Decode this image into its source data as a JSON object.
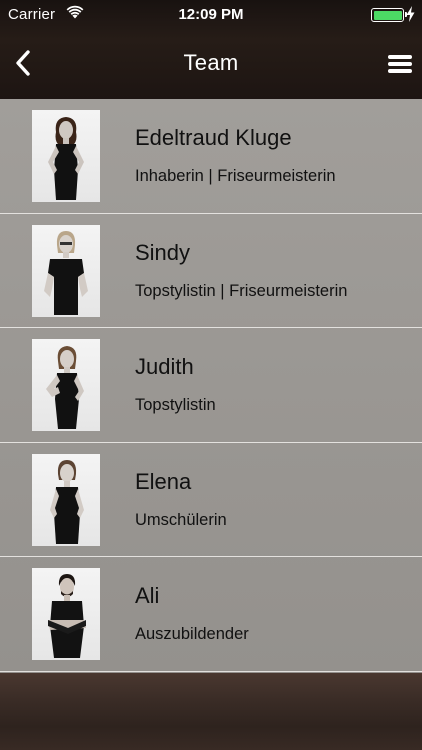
{
  "status_bar": {
    "carrier": "Carrier",
    "time": "12:09 PM",
    "battery_level": 1.0
  },
  "nav": {
    "title": "Team",
    "back_icon": "chevron-left-icon",
    "menu_icon": "hamburger-menu-icon"
  },
  "team": [
    {
      "name": "Edeltraud Kluge",
      "role": "Inhaberin | Friseurmeisterin"
    },
    {
      "name": "Sindy",
      "role": "Topstylistin | Friseurmeisterin"
    },
    {
      "name": "Judith",
      "role": "Topstylistin"
    },
    {
      "name": "Elena",
      "role": "Umschülerin"
    },
    {
      "name": "Ali",
      "role": "Auszubildender"
    }
  ],
  "colors": {
    "battery": "#4cd964",
    "list_background": "#9c9995",
    "separator": "#e3e1de"
  }
}
